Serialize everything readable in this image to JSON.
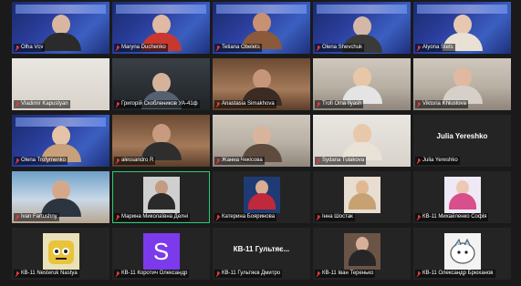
{
  "meeting": {
    "participants": [
      {
        "name": "Olha Vcv",
        "muted": true
      },
      {
        "name": "Maryna Duchenko",
        "muted": true
      },
      {
        "name": "Tetiana Obelets",
        "muted": true
      },
      {
        "name": "Olena Shevchuk",
        "muted": true
      },
      {
        "name": "Alyona Stets",
        "muted": true
      },
      {
        "name": "Vladimir Kapustyan",
        "muted": true
      },
      {
        "name": "Григорій Скоблеников УА-41ф",
        "muted": true
      },
      {
        "name": "Anastasia Simakhova",
        "muted": true
      },
      {
        "name": "Trofi Olha Ilyash",
        "muted": true
      },
      {
        "name": "Viktoria Khlustova",
        "muted": true
      },
      {
        "name": "Olena Trofymenko",
        "muted": true
      },
      {
        "name": "alessandro R",
        "muted": true
      },
      {
        "name": "Жанна Чекісова",
        "muted": true
      },
      {
        "name": "Sydana Tulakova",
        "muted": true
      },
      {
        "name": "Julia Yereshko",
        "muted": true,
        "big_name": "Julia Yereshko"
      },
      {
        "name": "Ivan Fartushny",
        "muted": true
      },
      {
        "name": "Марина Миколаївна Делні",
        "muted": true
      },
      {
        "name": "Катерина Бояринова",
        "muted": true
      },
      {
        "name": "Інна Шостак",
        "muted": true
      },
      {
        "name": "КВ-11 Михайленко Софія",
        "muted": true
      },
      {
        "name": "КВ-11 Nesteruk Nastya",
        "muted": true
      },
      {
        "name": "КВ-11 Коротич Олександр",
        "muted": true,
        "avatar_letter": "S"
      },
      {
        "name": "КВ-11 Гультяєв Дмитро",
        "muted": true,
        "big_name": "КВ-11 Гультяє..."
      },
      {
        "name": "КВ-11 Іван Теренько",
        "muted": true
      },
      {
        "name": "КВ-11 Олександр Брюханов",
        "muted": true
      }
    ]
  },
  "colors": {
    "active_speaker_border": "#2ecc71",
    "muted_icon": "#e23b3b",
    "avatar_purple": "#7c3aed"
  }
}
